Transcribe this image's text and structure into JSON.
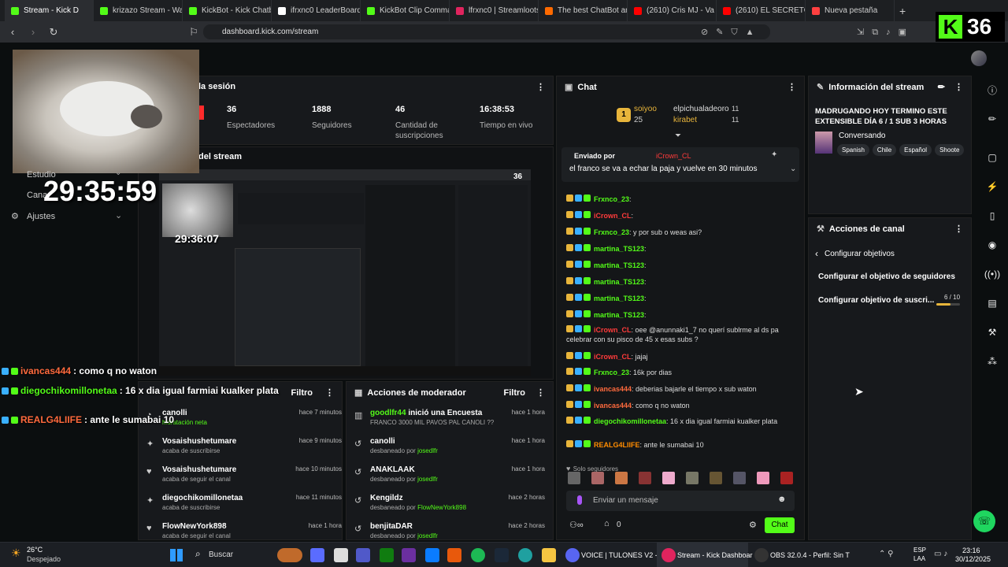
{
  "browser": {
    "tabs": [
      {
        "label": "Stream - Kick D",
        "color": "#53fc18",
        "active": true
      },
      {
        "label": "krizazo Stream - Watch",
        "color": "#53fc18"
      },
      {
        "label": "KickBot - Kick Chatbot",
        "color": "#53fc18"
      },
      {
        "label": "ifrxnc0 LeaderBoard |",
        "color": "#ffffff"
      },
      {
        "label": "KickBot Clip Command",
        "color": "#53fc18"
      },
      {
        "label": "lfrxnc0 | Streamloots |",
        "color": "#e0245e"
      },
      {
        "label": "The best ChatBot and",
        "color": "#ff6a00"
      },
      {
        "label": "(2610) Cris MJ - Va",
        "color": "#ff0000"
      },
      {
        "label": "(2610) EL SECRETO FIN",
        "color": "#ff0000"
      },
      {
        "label": "Nueva pestaña",
        "color": "#ff4040"
      }
    ],
    "new_tab": "+",
    "url": "dashboard.kick.com/stream"
  },
  "kick_badge": {
    "letter": "K",
    "count": "36"
  },
  "stats_panel": {
    "title": "la sesión",
    "items": [
      {
        "value": "36",
        "label": "Espectadores"
      },
      {
        "value": "1888",
        "label": "Seguidores"
      },
      {
        "value": "46",
        "label": "Cantidad de suscripciones"
      },
      {
        "value": "16:38:53",
        "label": "Tiempo en vivo"
      }
    ]
  },
  "stream_panel": {
    "title": "del stream",
    "timer": "29:35:59",
    "inner_timer": "29:36:07",
    "inner_count": "36"
  },
  "left_menu": {
    "items": [
      "Estudio",
      "Cana",
      "Ajustes"
    ]
  },
  "overlay_chat": [
    {
      "user": "ivancas444",
      "text": ": como q no waton",
      "color": "#ff6a3d"
    },
    {
      "user": "diegochikomillonetaa",
      "text": ": 16 x dia igual farmiai kualker plata",
      "color": "#53fc18"
    },
    {
      "user": "REALG4LIIFE",
      "text": ": ante le sumabai 10",
      "color": "#ff6a3d"
    }
  ],
  "activity_feed": {
    "filter": "Filtro",
    "items": [
      {
        "name": "canolli",
        "sub": "hidratación neta",
        "time": "hace 7 minutos",
        "icon": "gift-icon"
      },
      {
        "name": "Vosaishushetumare",
        "sub": "acaba de suscribirse",
        "time": "hace 9 minutos",
        "icon": "star-icon"
      },
      {
        "name": "Vosaishushetumare",
        "sub": "acaba de seguir el canal",
        "time": "hace 10 minutos",
        "icon": "heart-icon"
      },
      {
        "name": "diegochikomillonetaa",
        "sub": "acaba de suscribirse",
        "time": "hace 11 minutos",
        "icon": "star-icon"
      },
      {
        "name": "FlowNewYork898",
        "sub": "acaba de seguir el canal",
        "time": "hace 1 hora",
        "icon": "heart-icon"
      }
    ]
  },
  "mod_actions": {
    "title": "Acciones de moderador",
    "filter": "Filtro",
    "items": [
      {
        "name": "goodlfr44",
        "action": " inició una Encuesta",
        "sub": "FRANCO 3000 MIL PAVOS PAL CANOLI ??",
        "time": "hace 1 hora",
        "by": ""
      },
      {
        "name": "canolli",
        "action": "",
        "sub": "desbaneado por ",
        "by": "josedlfr",
        "time": "hace 1 hora"
      },
      {
        "name": "ANAKLAAK",
        "action": "",
        "sub": "desbaneado por ",
        "by": "josedlfr",
        "time": "hace 1 hora"
      },
      {
        "name": "Kengildz",
        "action": "",
        "sub": "desbaneado por ",
        "by": "FlowNewYork898",
        "time": "hace 2 horas"
      },
      {
        "name": "benjitaDAR",
        "action": "",
        "sub": "desbaneado por ",
        "by": "josedlfr",
        "time": "hace 2 horas"
      }
    ]
  },
  "chat": {
    "title": "Chat",
    "top_users": [
      {
        "name": "soiyoo",
        "count": "25"
      },
      {
        "name": "elpichualadeoro",
        "count": "11"
      },
      {
        "name": "kirabet",
        "count": "11"
      }
    ],
    "pinned": {
      "label": "Enviado por",
      "user": "iCrown_CL",
      "text": "el franco se va a echar la paja y vuelve en 30 minutos"
    },
    "messages": [
      {
        "user": "Frxnco_23",
        "text": ":",
        "color": "#53fc18"
      },
      {
        "user": "iCrown_CL",
        "text": ":",
        "color": "#ff3b3b"
      },
      {
        "user": "Frxnco_23",
        "text": ": y por sub o weas asi?",
        "color": "#53fc18"
      },
      {
        "user": "martina_TS123",
        "text": ":",
        "color": "#53fc18"
      },
      {
        "user": "martina_TS123",
        "text": ":",
        "color": "#53fc18"
      },
      {
        "user": "martina_TS123",
        "text": ":",
        "color": "#53fc18"
      },
      {
        "user": "martina_TS123",
        "text": ":",
        "color": "#53fc18"
      },
      {
        "user": "martina_TS123",
        "text": ":",
        "color": "#53fc18"
      },
      {
        "user": "iCrown_CL",
        "text": ": oee @anunnaki1_7 no querí sublrme al ds pa celebrar con su pisco de 45 x esas subs ?",
        "color": "#ff3b3b"
      },
      {
        "user": "iCrown_CL",
        "text": ": jajaj",
        "color": "#ff3b3b"
      },
      {
        "user": "Frxnco_23",
        "text": ": 16k por dias",
        "color": "#53fc18"
      },
      {
        "user": "ivancas444",
        "text": ": deberias bajarle el tiempo x sub waton",
        "color": "#ff6a3d"
      },
      {
        "user": "ivancas444",
        "text": ": como q no waton",
        "color": "#ff6a3d"
      },
      {
        "user": "diegochikomillonetaa",
        "text": ": 16 x dia igual farmiai kualker plata",
        "color": "#53fc18"
      },
      {
        "user": "REALG4LIIFE",
        "text": ": ante le sumabai 10",
        "color": "#ff8c00"
      }
    ],
    "followers_only": "Solo seguidores",
    "input_placeholder": "Enviar un mensaje",
    "points": "0",
    "send": "Chat"
  },
  "stream_info": {
    "title": "Información del stream",
    "stream_title": "MADRUGANDO HOY TERMINO ESTE EXTENSIBLE DÍA 6 / 1 SUB 3 HORAS",
    "category": "Conversando",
    "tags": [
      "Spanish",
      "Chile",
      "Español",
      "Shoote"
    ]
  },
  "channel_actions": {
    "title": "Acciones de canal",
    "back": "Configurar objetivos",
    "items": [
      {
        "label": "Configurar el objetivo de seguidores"
      },
      {
        "label": "Configurar objetivo de suscri...",
        "progress": "6 / 10",
        "fraction": 0.6
      }
    ]
  },
  "taskbar": {
    "weather_temp": "26°C",
    "weather_desc": "Despejado",
    "search": "Buscar",
    "apps": [
      {
        "label": "VOICE | TULONES V2 - D"
      },
      {
        "label": "Stream - Kick Dashboar"
      },
      {
        "label": "OBS 32.0.4 - Perfil: Sin T"
      }
    ],
    "lang": "ESP",
    "lang2": "LAA",
    "time": "23:16",
    "date": "30/12/2025"
  }
}
